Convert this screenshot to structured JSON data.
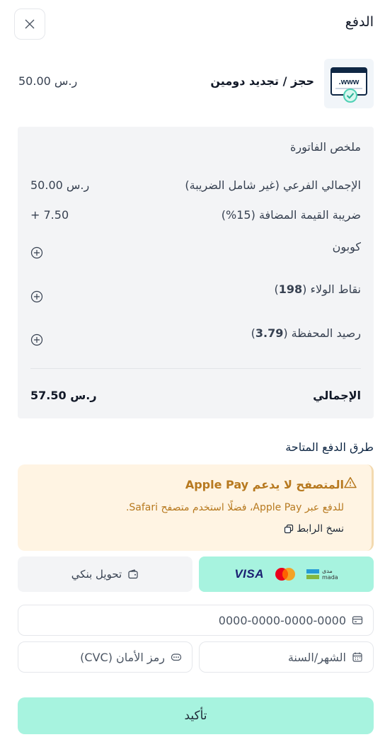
{
  "header": {
    "title": "الدفع"
  },
  "product": {
    "name": "حجز / تجديد دومين",
    "price": "50.00 ر.س",
    "thumb_text": "www."
  },
  "summary": {
    "title": "ملخص الفاتورة",
    "subtotal_label": "الإجمالي الفرعي (غير شامل الضريبة)",
    "subtotal_value": "50.00 ر.س",
    "vat_label": "ضريبة القيمة المضافة (15%)",
    "vat_value": "+ 7.50",
    "coupon_label": "كوبون",
    "loyalty_label": "نقاط الولاء (",
    "loyalty_points": "198",
    "loyalty_close": ")",
    "wallet_label": "رصيد المحفظة (",
    "wallet_balance": "3.79",
    "wallet_close": ")",
    "total_label": "الإجمالي",
    "total_value": "57.50 ر.س"
  },
  "payment": {
    "section_title": "طرق الدفع المتاحة",
    "warning_title": "المتصفح لا يدعم Apple Pay",
    "warning_text": "للدفع عبر Apple Pay، فضلًا استخدم متصفح Safari.",
    "copy_link": "نسخ الرابط",
    "card_brands": {
      "visa": "VISA",
      "mastercard": "MasterCard",
      "mada_ar": "مدى",
      "mada_en": "mada"
    },
    "bank_transfer": "تحويل بنكي",
    "card_number_placeholder": "0000-0000-0000-0000",
    "expiry_placeholder": "الشهر/السنة",
    "cvc_placeholder": "رمز الأمان (CVC)",
    "confirm": "تأكيد"
  },
  "colors": {
    "accent": "#a7f3df",
    "warning_bg": "#fff4e3",
    "warning_text": "#b7791f",
    "summary_bg": "#f3f4f6"
  }
}
